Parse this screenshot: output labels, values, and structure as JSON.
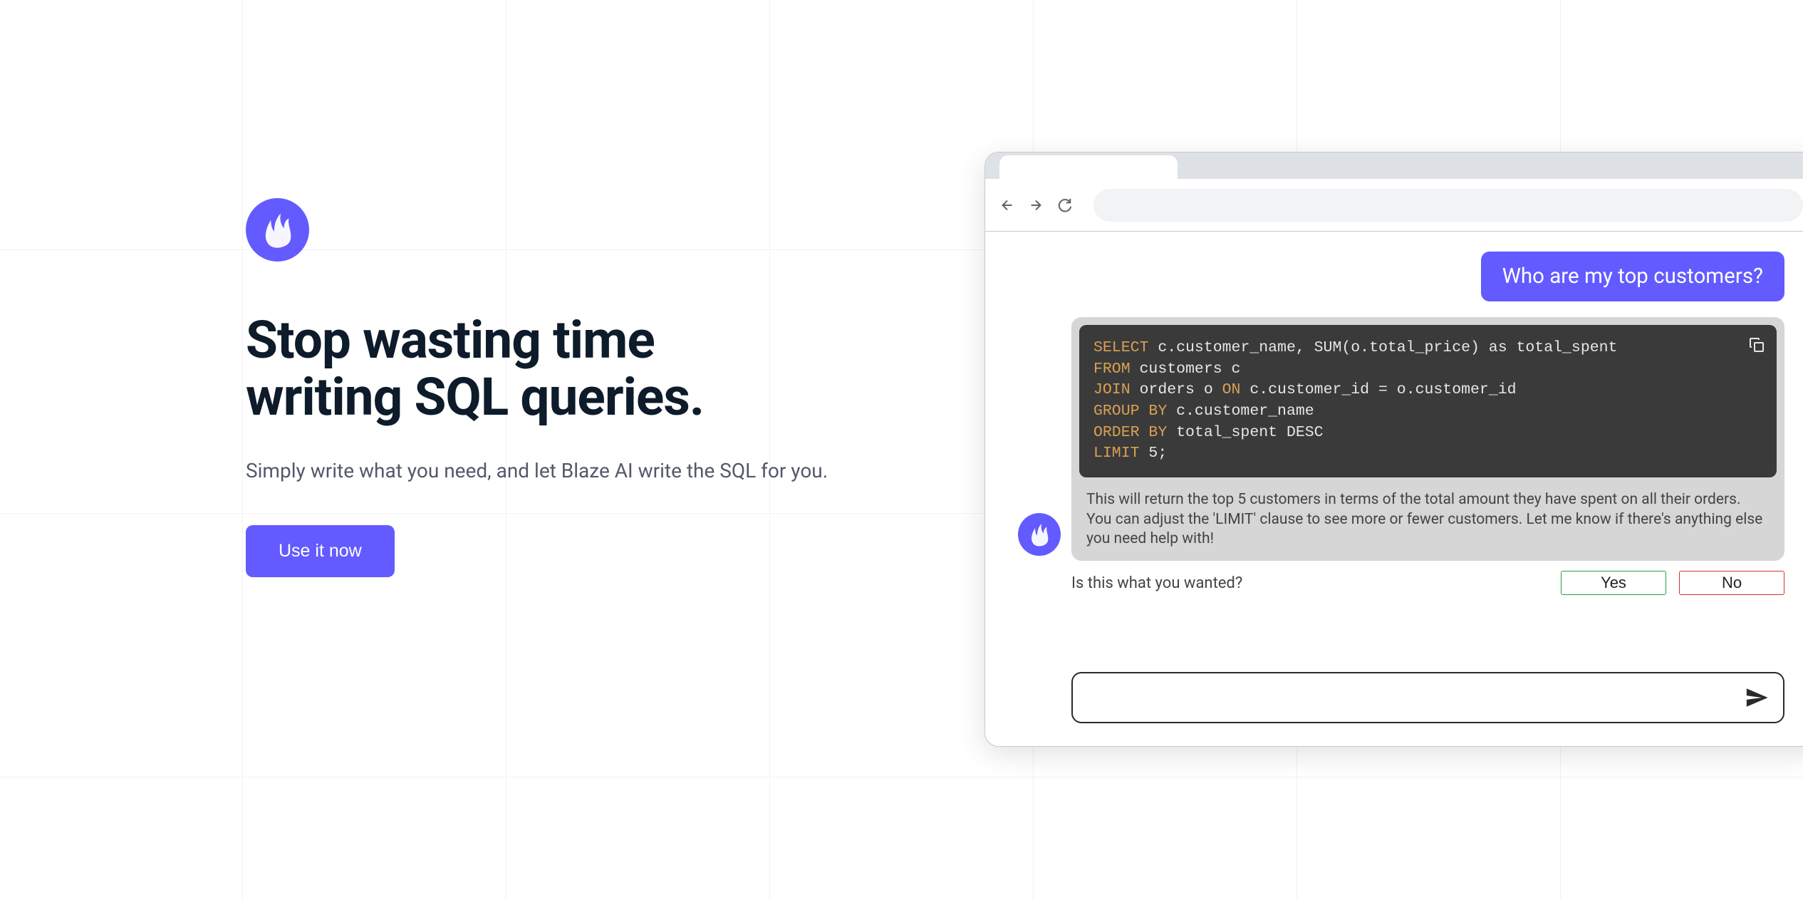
{
  "hero": {
    "headline_l1": "Stop wasting time",
    "headline_l2": "writing SQL queries.",
    "subheadline": "Simply write what you need, and let Blaze AI write the SQL for you.",
    "cta_label": "Use it now"
  },
  "chat": {
    "user_message": "Who are my top customers?",
    "sql": {
      "line1": {
        "kw": "SELECT",
        "rest": " c.customer_name, SUM(o.total_price) as total_spent"
      },
      "line2": {
        "kw": "FROM",
        "rest": " customers c"
      },
      "line3": {
        "kw1": "JOIN",
        "mid": " orders o ",
        "kw2": "ON",
        "rest": " c.customer_id = o.customer_id"
      },
      "line4": {
        "kw": "GROUP BY",
        "rest": " c.customer_name"
      },
      "line5": {
        "kw": "ORDER BY",
        "rest": " total_spent DESC"
      },
      "line6": {
        "kw": "LIMIT",
        "rest": " 5;"
      }
    },
    "explanation": "This will return the top 5 customers in terms of the total amount they have spent on all their orders. You can adjust the 'LIMIT' clause to see more or fewer customers. Let me know if there's anything else you need help with!",
    "feedback_prompt": "Is this what you wanted?",
    "feedback_yes": "Yes",
    "feedback_no": "No",
    "input_placeholder": ""
  },
  "colors": {
    "primary": "#635bff"
  }
}
